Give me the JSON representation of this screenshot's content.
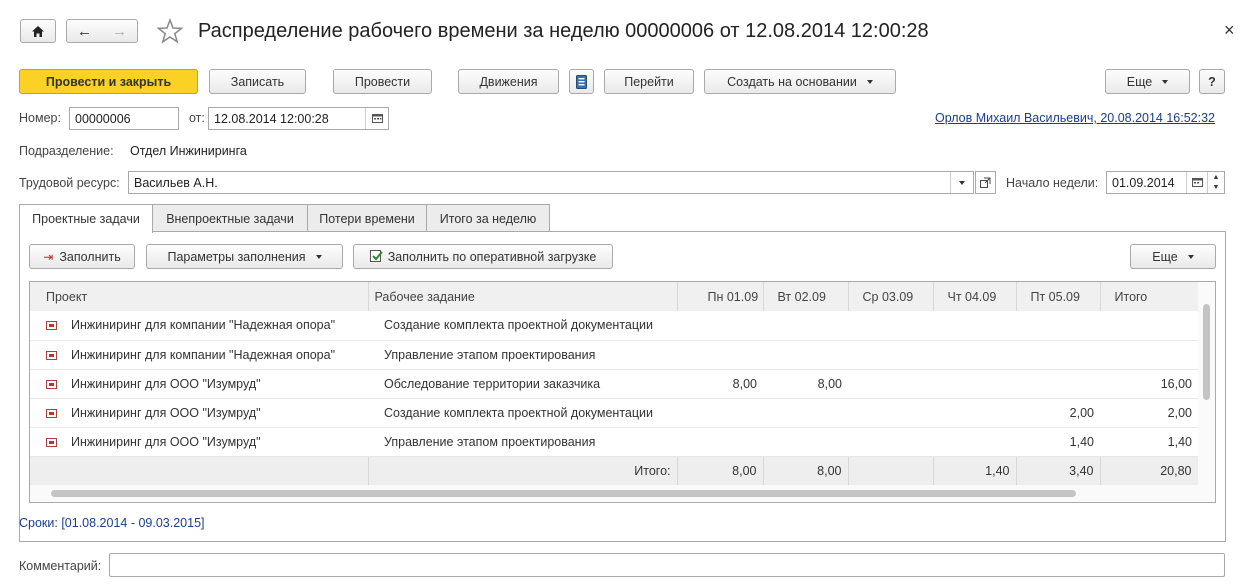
{
  "window": {
    "title": "Распределение рабочего времени за неделю 00000006 от 12.08.2014 12:00:28",
    "close_glyph": "×"
  },
  "toolbar": {
    "post_and_close": "Провести и закрыть",
    "save": "Записать",
    "post": "Провести",
    "movements": "Движения",
    "go_to": "Перейти",
    "create_based_on": "Создать на основании",
    "more": "Еще",
    "help": "?"
  },
  "header": {
    "number_label": "Номер:",
    "number_value": "00000006",
    "date_label": "от:",
    "date_value": "12.08.2014 12:00:28",
    "author_link": "Орлов Михаил Васильевич, 20.08.2014 16:52:32",
    "department_label": "Подразделение:",
    "department_value": "Отдел Инжиниринга",
    "resource_label": "Трудовой ресурс:",
    "resource_value": "Васильев А.Н.",
    "week_start_label": "Начало недели:",
    "week_start_value": "01.09.2014"
  },
  "tabs": [
    {
      "label": "Проектные задачи",
      "active": true
    },
    {
      "label": "Внепроектные задачи",
      "active": false
    },
    {
      "label": "Потери времени",
      "active": false
    },
    {
      "label": "Итого за неделю",
      "active": false
    }
  ],
  "table_toolbar": {
    "fill": "Заполнить",
    "fill_params": "Параметры заполнения",
    "fill_by_workload": "Заполнить по оперативной загрузке",
    "more": "Еще"
  },
  "table": {
    "columns": [
      "Проект",
      "Рабочее задание",
      "Пн 01.09",
      "Вт 02.09",
      "Ср 03.09",
      "Чт 04.09",
      "Пт 05.09",
      "Итого"
    ],
    "rows": [
      [
        "Инжиниринг для компании \"Надежная опора\"",
        "Создание комплекта проектной документации",
        "",
        "",
        "",
        "",
        "",
        ""
      ],
      [
        "Инжиниринг для компании \"Надежная опора\"",
        "Управление этапом проектирования",
        "",
        "",
        "",
        "",
        "",
        ""
      ],
      [
        "Инжиниринг для ООО \"Изумруд\"",
        "Обследование территории заказчика",
        "8,00",
        "8,00",
        "",
        "",
        "",
        "16,00"
      ],
      [
        "Инжиниринг для ООО \"Изумруд\"",
        "Создание комплекта проектной документации",
        "",
        "",
        "",
        "",
        "2,00",
        "2,00"
      ],
      [
        "Инжиниринг для ООО \"Изумруд\"",
        "Управление этапом проектирования",
        "",
        "",
        "",
        "",
        "1,40",
        "1,40"
      ]
    ],
    "totals": [
      "",
      "Итого:",
      "8,00",
      "8,00",
      "",
      "1,40",
      "3,40",
      "20,80"
    ]
  },
  "terms_text": "Сроки: [01.08.2014 - 09.03.2015]",
  "comment_label": "Комментарий:",
  "comment_value": "",
  "colors": {
    "primary_button": "#fbd125",
    "link": "#1b3d8f",
    "terms": "#1b3d8f"
  }
}
